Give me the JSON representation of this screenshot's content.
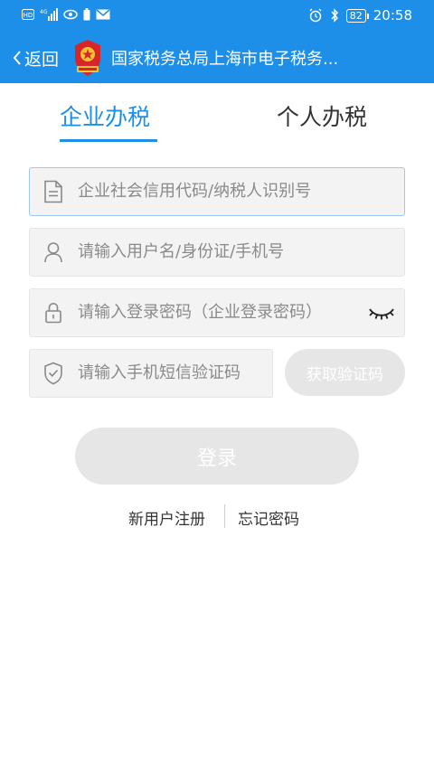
{
  "status_bar": {
    "left_icons": [
      "hd-icon",
      "4g-signal-icon",
      "signal-icon",
      "eye-icon",
      "battery-saver-icon",
      "mail-icon"
    ],
    "battery": "82",
    "time": "20:58"
  },
  "header": {
    "back_label": "返回",
    "title": "国家税务总局上海市电子税务..."
  },
  "tabs": [
    {
      "label": "企业办税",
      "active": true
    },
    {
      "label": "个人办税",
      "active": false
    }
  ],
  "form": {
    "credit_code_placeholder": "企业社会信用代码/纳税人识别号",
    "username_placeholder": "请输入用户名/身份证/手机号",
    "password_placeholder": "请输入登录密码（企业登录密码）",
    "sms_placeholder": "请输入手机短信验证码",
    "get_code_label": "获取验证码",
    "login_label": "登录"
  },
  "links": {
    "register": "新用户注册",
    "forgot": "忘记密码"
  },
  "colors": {
    "brand_blue": "#1e8fe8",
    "disabled_button": "#e6e6e6",
    "field_bg": "#f3f3f3"
  }
}
